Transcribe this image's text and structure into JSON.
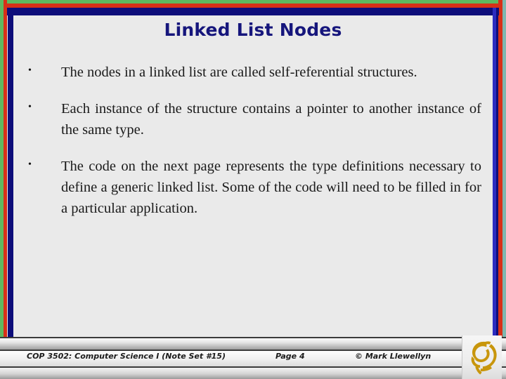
{
  "slide": {
    "title": "Linked List Nodes",
    "title_color": "#16167c",
    "background_color": "#eaeaea",
    "border_colors": {
      "outer_green": "#5fb85f",
      "outer_red": "#d83018",
      "inner_navy": "#0d0d7a",
      "inner_blue": "#2b2bbf",
      "right_teal": "#7fb8b0"
    },
    "bullets": [
      {
        "marker": "•",
        "text": "The nodes in a linked list are called self-referential structures."
      },
      {
        "marker": "•",
        "text": "Each instance of the structure contains a pointer to another instance of the same type."
      },
      {
        "marker": "•",
        "text": "The code on the next page represents the type definitions necessary to define a generic linked list. Some of the code will need to be filled in for a particular application."
      }
    ]
  },
  "footer": {
    "course": "COP 3502: Computer Science I  (Note Set #15)",
    "page": "Page 4",
    "copyright": "© Mark Llewellyn",
    "logo_name": "ucf-pegasus-logo",
    "logo_color": "#c8960c"
  }
}
